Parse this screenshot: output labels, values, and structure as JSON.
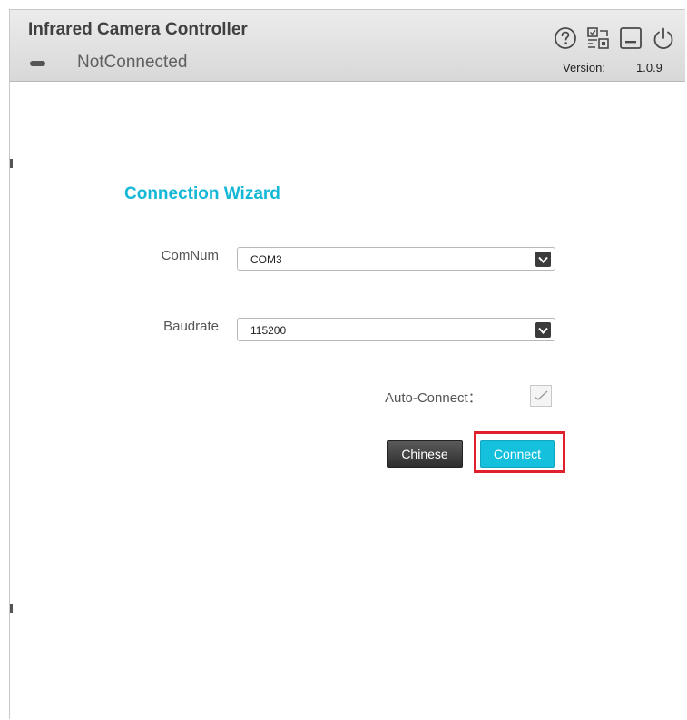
{
  "header": {
    "title": "Infrared Camera Controller",
    "status": "NotConnected",
    "version_label": "Version:",
    "version_value": "1.0.9",
    "icons": [
      "help-icon",
      "settings-icon",
      "minimize-icon",
      "power-icon"
    ]
  },
  "wizard": {
    "title": "Connection Wizard",
    "comnum": {
      "label": "ComNum",
      "value": "COM3"
    },
    "baudrate": {
      "label": "Baudrate",
      "value": "115200"
    },
    "auto_connect": {
      "label": "Auto-Connect：",
      "checked": true
    },
    "buttons": {
      "language_label": "Chinese",
      "connect_label": "Connect"
    }
  },
  "colors": {
    "accent": "#14b8d6",
    "highlight": "#e0202c",
    "header_bg": "#e2e2e2"
  }
}
